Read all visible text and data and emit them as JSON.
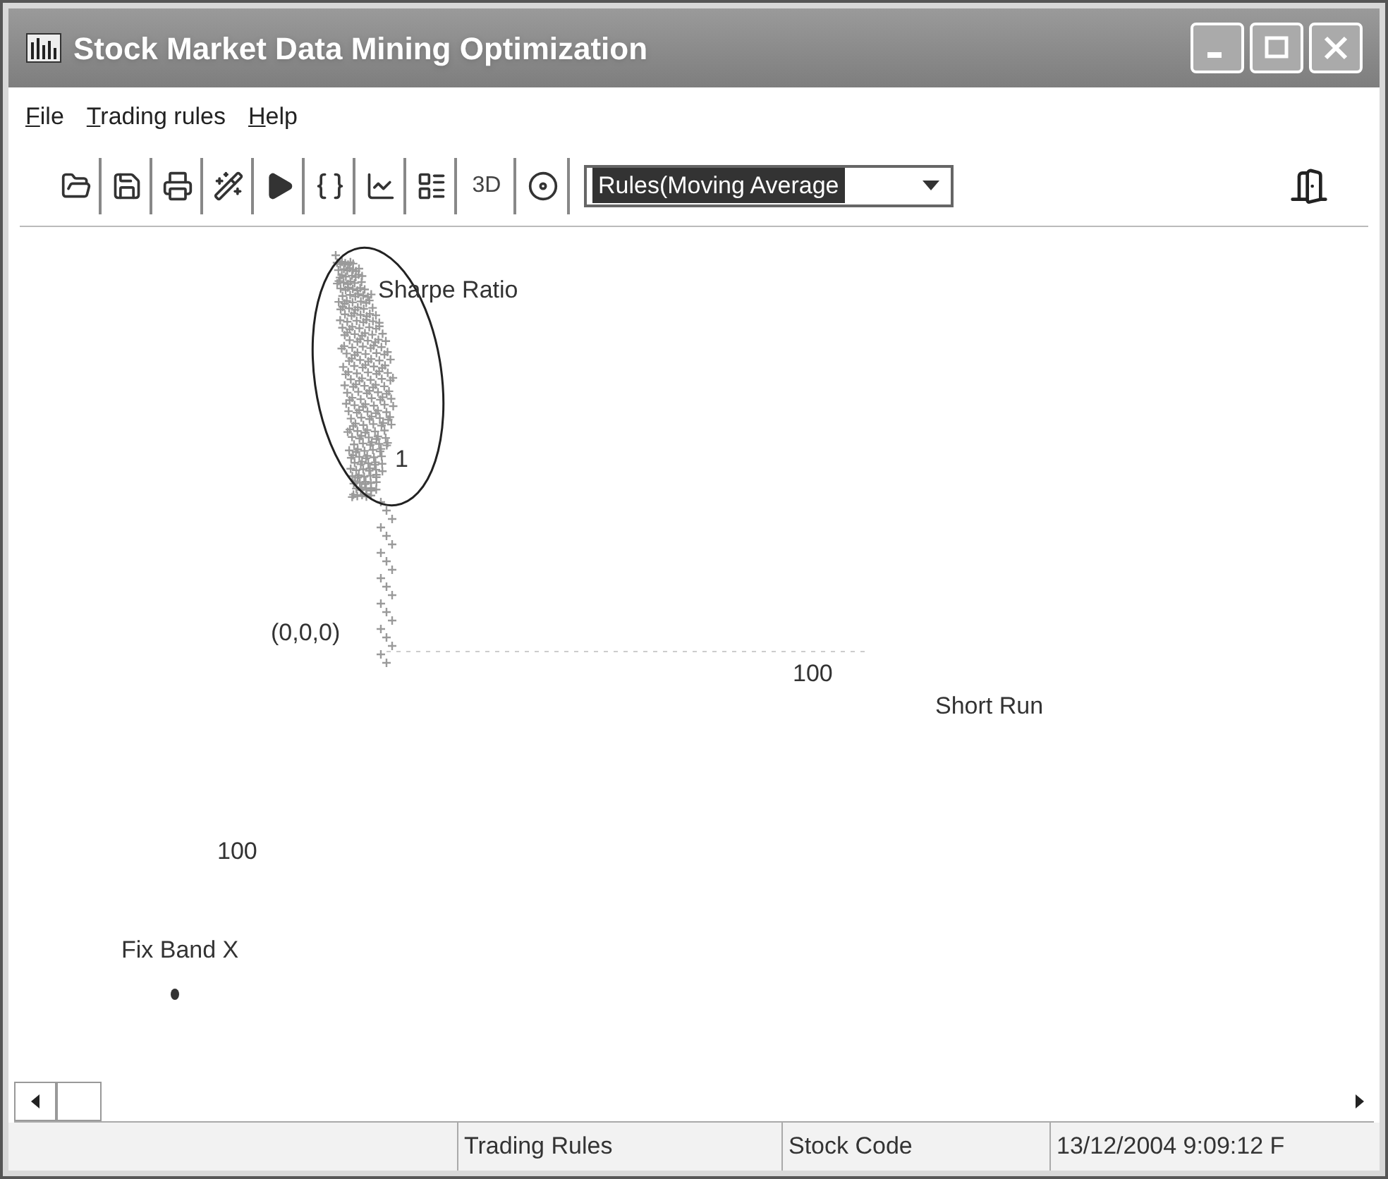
{
  "window": {
    "title": "Stock Market Data Mining Optimization"
  },
  "menu": [
    {
      "label": "File"
    },
    {
      "label": "Trading rules"
    },
    {
      "label": "Help"
    }
  ],
  "toolbar": {
    "text_button": "3D",
    "combo": {
      "value": "Rules(Moving Average"
    }
  },
  "plot": {
    "labels": [
      "Sharpe Ratio",
      "1",
      "(0,0,0)",
      "100",
      "Short Run",
      "100",
      "Fix Band X"
    ]
  },
  "status_bar": [
    "Trading Rules",
    "Stock Code",
    "13/12/2004 9:09:12 F"
  ]
}
